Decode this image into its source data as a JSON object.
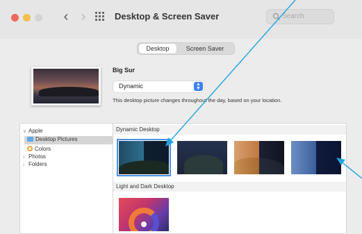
{
  "window": {
    "title": "Desktop & Screen Saver",
    "search_placeholder": "Search"
  },
  "tabs": [
    {
      "label": "Desktop",
      "selected": true
    },
    {
      "label": "Screen Saver",
      "selected": false
    }
  ],
  "current": {
    "name": "Big Sur",
    "mode": "Dynamic",
    "description": "This desktop picture changes throughout the day, based on your location."
  },
  "sidebar": {
    "apple": "Apple",
    "desktop_pictures": "Desktop Pictures",
    "colors": "Colors",
    "photos": "Photos",
    "folders": "Folders"
  },
  "sections": {
    "dynamic": "Dynamic Desktop",
    "light_dark": "Light and Dark Desktop"
  },
  "colors": {
    "accent": "#3b82f6",
    "annotation": "#1fa3e0"
  }
}
